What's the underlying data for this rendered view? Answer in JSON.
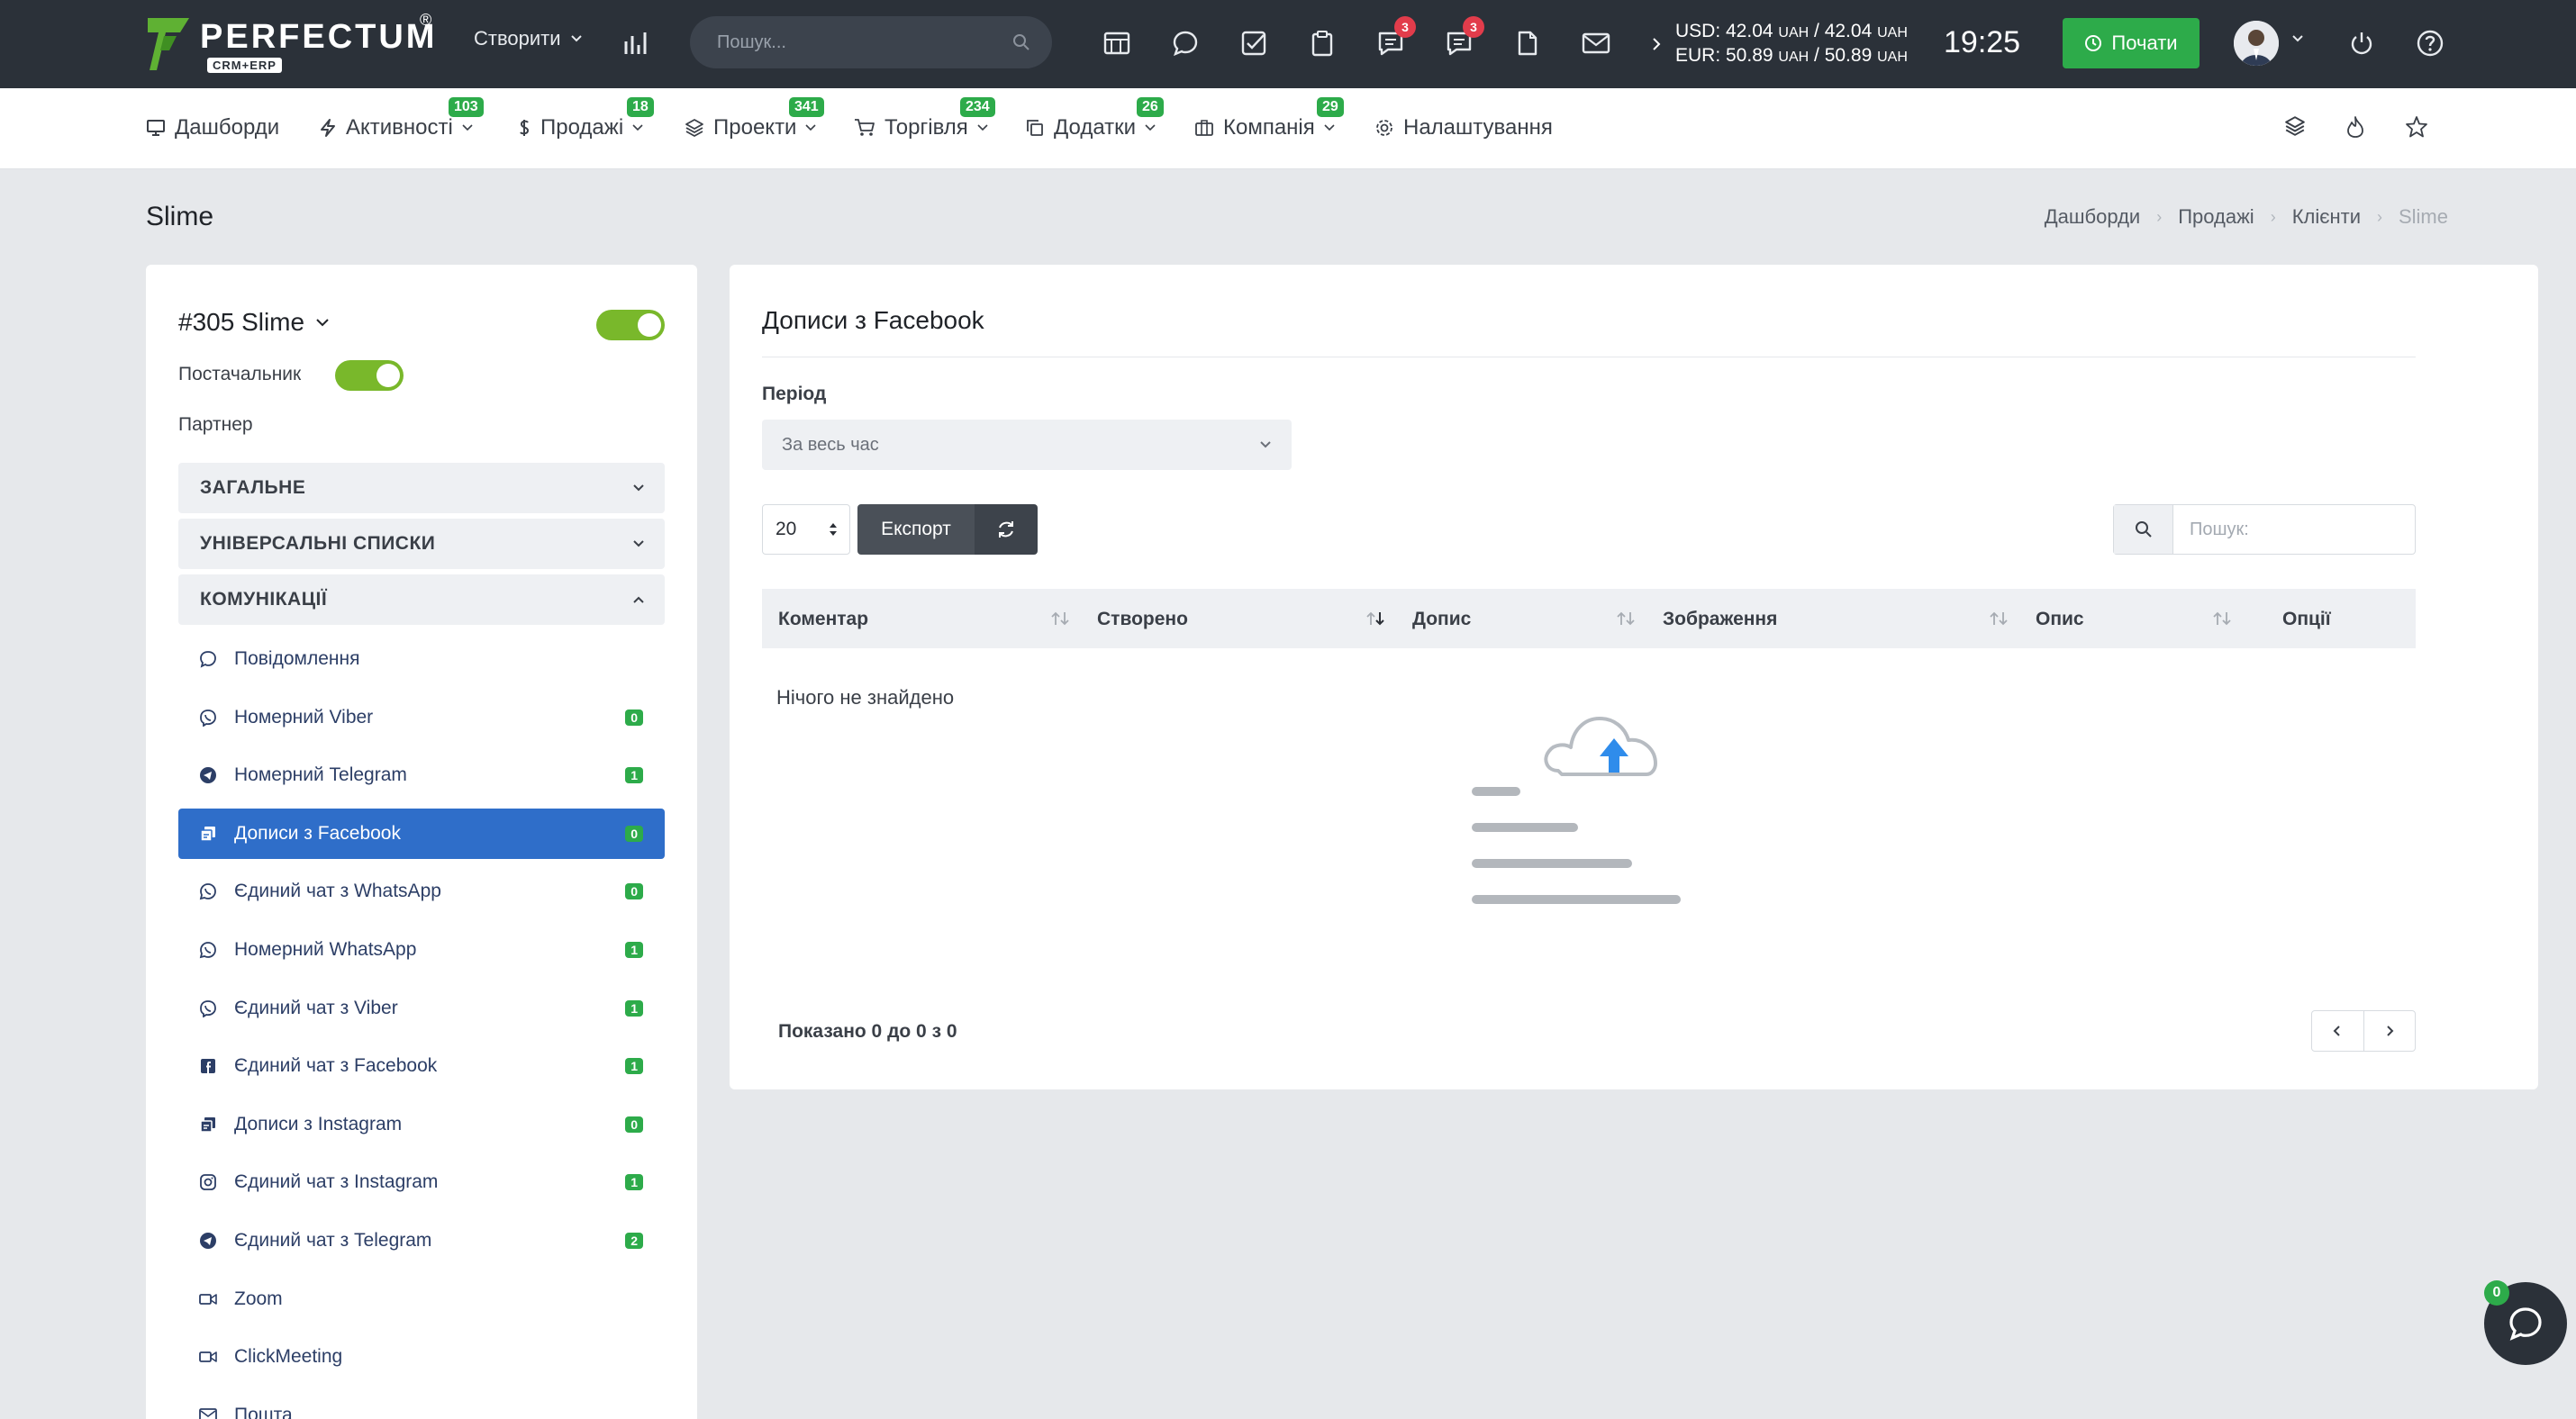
{
  "app": {
    "logo_text": "PERFECTUM",
    "logo_sub": "CRM+ERP",
    "logo_reg": "®"
  },
  "topbar": {
    "create_label": "Створити",
    "search_placeholder": "Пошук...",
    "notif_badges": [
      "3",
      "3"
    ],
    "rates": {
      "usd": "USD: 42.04",
      "usd_unit1": "UAH",
      "usd_mid": "/ 42.04",
      "usd_unit2": "UAH",
      "eur": "EUR: 50.89",
      "eur_unit1": "UAH",
      "eur_mid": "/ 50.89",
      "eur_unit2": "UAH"
    },
    "time": "19:25",
    "start_label": "Почати"
  },
  "nav": {
    "items": [
      {
        "label": "Дашборди",
        "badge": ""
      },
      {
        "label": "Активності",
        "badge": "103"
      },
      {
        "label": "Продажі",
        "badge": "18"
      },
      {
        "label": "Проекти",
        "badge": "341"
      },
      {
        "label": "Торгівля",
        "badge": "234"
      },
      {
        "label": "Додатки",
        "badge": "26"
      },
      {
        "label": "Компанія",
        "badge": "29"
      },
      {
        "label": "Налаштування",
        "badge": ""
      }
    ]
  },
  "page": {
    "title": "Slime",
    "breadcrumb": [
      "Дашборди",
      "Продажі",
      "Клієнти",
      "Slime"
    ]
  },
  "client": {
    "name": "#305 Slime",
    "supplier_label": "Постачальник",
    "partner_label": "Партнер",
    "sections": [
      "ЗАГАЛЬНЕ",
      "УНІВЕРСАЛЬНІ СПИСКИ",
      "КОМУНІКАЦІЇ"
    ],
    "menu": [
      {
        "label": "Повідомлення",
        "badge": "",
        "icon": "chat-icon"
      },
      {
        "label": "Номерний Viber",
        "badge": "0",
        "icon": "viber-icon"
      },
      {
        "label": "Номерний Telegram",
        "badge": "1",
        "icon": "telegram-icon"
      },
      {
        "label": "Дописи з Facebook",
        "badge": "0",
        "icon": "posts-icon"
      },
      {
        "label": "Єдиний чат з WhatsApp",
        "badge": "0",
        "icon": "whatsapp-icon"
      },
      {
        "label": "Номерний WhatsApp",
        "badge": "1",
        "icon": "whatsapp-icon"
      },
      {
        "label": "Єдиний чат з Viber",
        "badge": "1",
        "icon": "viber-icon"
      },
      {
        "label": "Єдиний чат з Facebook",
        "badge": "1",
        "icon": "facebook-icon"
      },
      {
        "label": "Дописи з Instagram",
        "badge": "0",
        "icon": "posts-icon"
      },
      {
        "label": "Єдиний чат з Instagram",
        "badge": "1",
        "icon": "instagram-icon"
      },
      {
        "label": "Єдиний чат з Telegram",
        "badge": "2",
        "icon": "telegram-icon"
      },
      {
        "label": "Zoom",
        "badge": "",
        "icon": "video-icon"
      },
      {
        "label": "ClickMeeting",
        "badge": "",
        "icon": "video-icon"
      },
      {
        "label": "Пошта",
        "badge": "",
        "icon": "mail-icon"
      }
    ]
  },
  "main": {
    "title": "Дописи з Facebook",
    "period_label": "Період",
    "period_value": "За весь час",
    "per_page": "20",
    "export_label": "Експорт",
    "search_placeholder": "Пошук:",
    "columns": [
      "Коментар",
      "Створено",
      "Допис",
      "Зображення",
      "Опис",
      "Опції"
    ],
    "empty_text": "Нічого не знайдено",
    "showing": "Показано 0 до 0 з 0"
  },
  "chat_widget": {
    "badge": "0"
  },
  "colors": {
    "topbar": "#2b3139",
    "accent_green": "#2dab4a",
    "active_blue": "#2f6ec9",
    "badge_red": "#e23c4b",
    "toggle_green": "#79b82b"
  }
}
